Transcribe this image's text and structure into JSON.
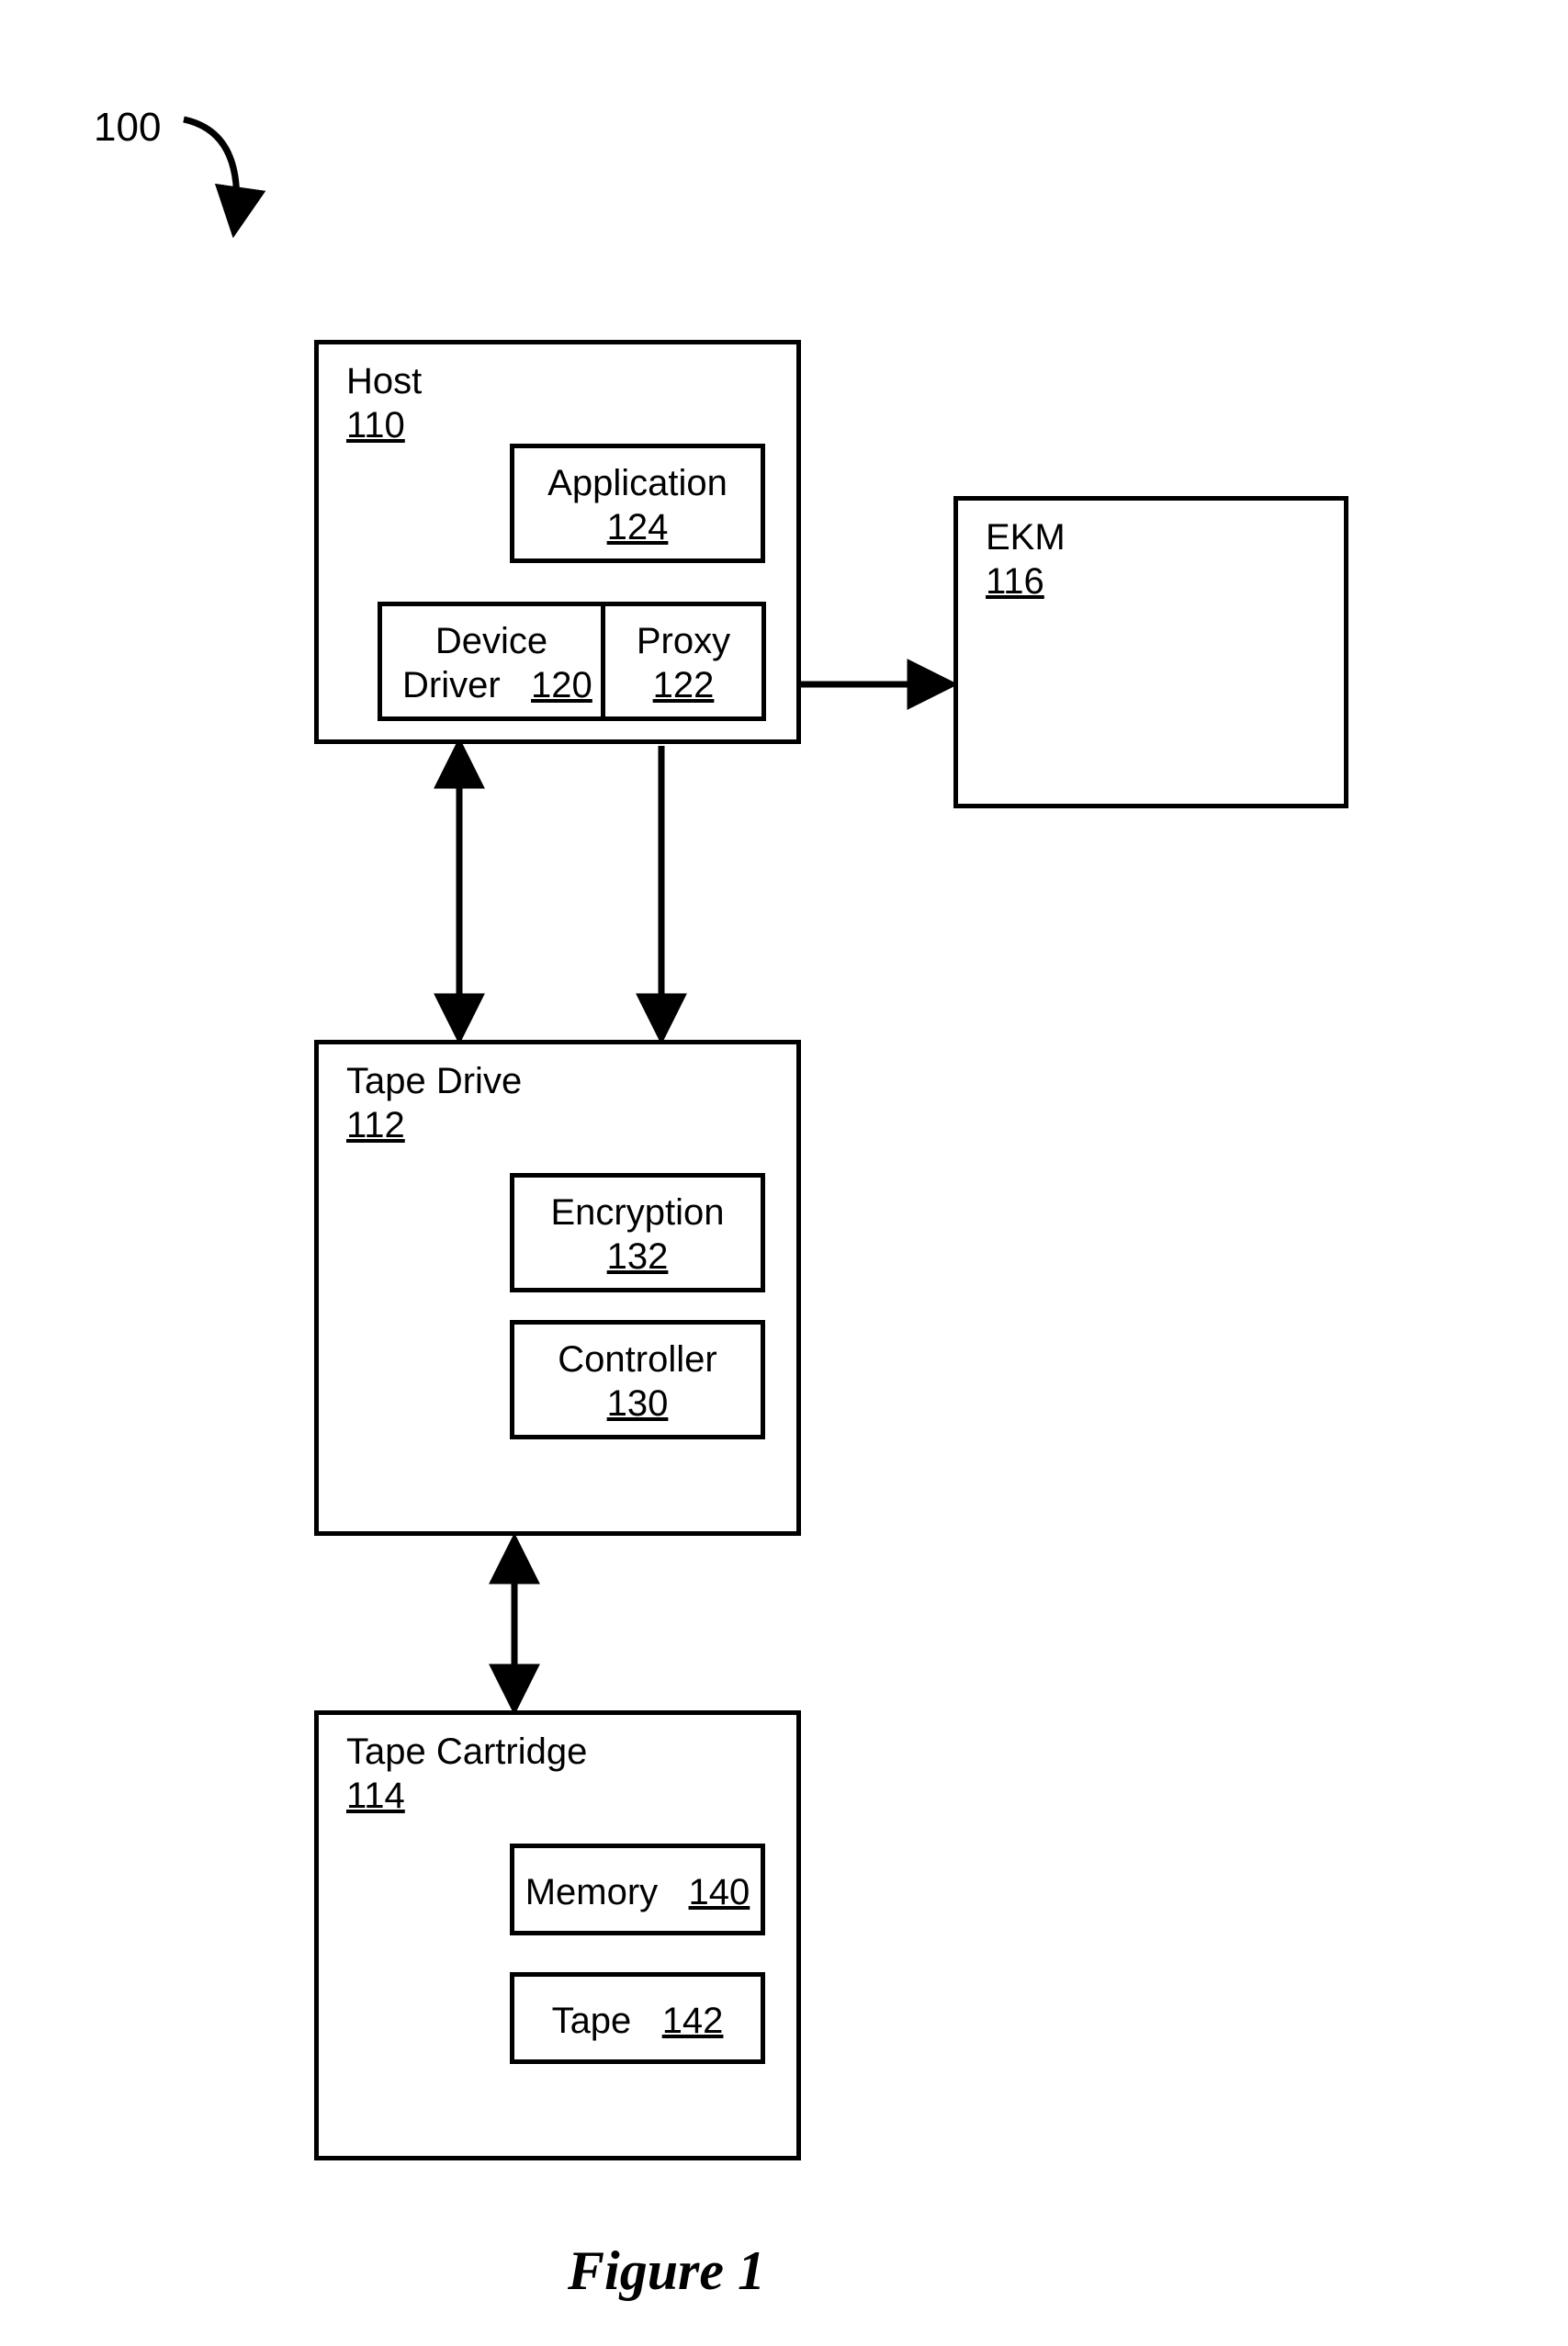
{
  "figure_label": "Figure 1",
  "reference_number": "100",
  "host": {
    "title": "Host",
    "number": "110",
    "application": {
      "title": "Application",
      "number": "124"
    },
    "device_driver": {
      "title_line1": "Device",
      "title_line2": "Driver",
      "number": "120"
    },
    "proxy": {
      "title": "Proxy",
      "number": "122"
    }
  },
  "ekm": {
    "title": "EKM",
    "number": "116"
  },
  "tape_drive": {
    "title": "Tape Drive",
    "number": "112",
    "encryption": {
      "title": "Encryption",
      "number": "132"
    },
    "controller": {
      "title": "Controller",
      "number": "130"
    }
  },
  "tape_cartridge": {
    "title": "Tape Cartridge",
    "number": "114",
    "memory": {
      "title": "Memory",
      "number": "140"
    },
    "tape": {
      "title": "Tape",
      "number": "142"
    }
  }
}
